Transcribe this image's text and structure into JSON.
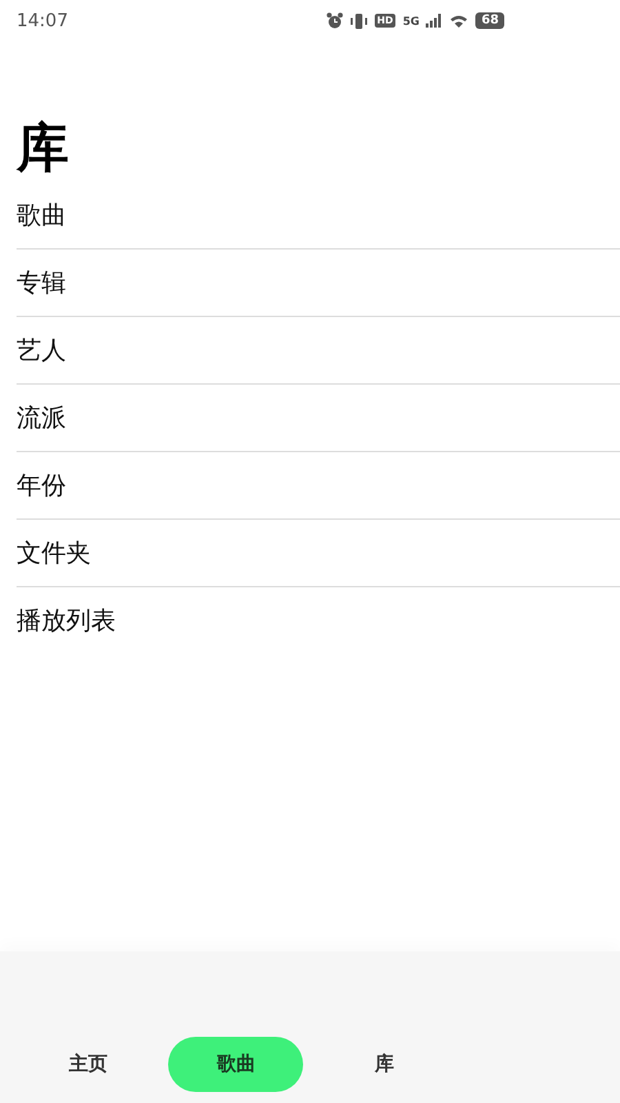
{
  "status_bar": {
    "time": "14:07",
    "hd": "HD",
    "network": "5G",
    "battery": "68"
  },
  "title": "库",
  "items": [
    "歌曲",
    "专辑",
    "艺人",
    "流派",
    "年份",
    "文件夹",
    "播放列表"
  ],
  "tabs": [
    {
      "label": "主页",
      "selected": false
    },
    {
      "label": "歌曲",
      "selected": true
    },
    {
      "label": "库",
      "selected": false
    }
  ]
}
